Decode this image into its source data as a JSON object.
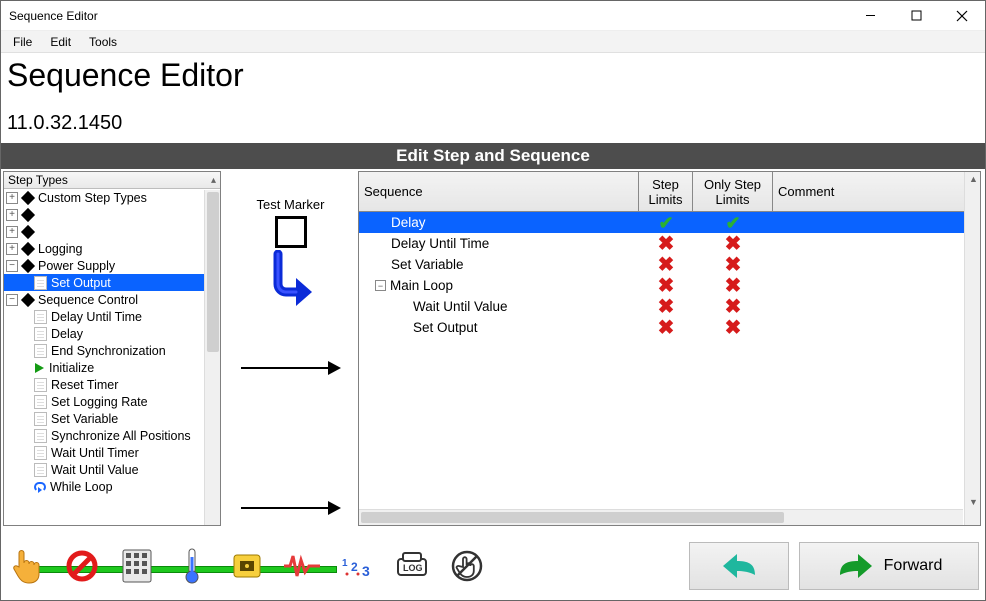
{
  "window": {
    "title": "Sequence Editor"
  },
  "menu": {
    "file": "File",
    "edit": "Edit",
    "tools": "Tools"
  },
  "header": {
    "title": "Sequence Editor",
    "version": "11.0.32.1450"
  },
  "band": {
    "title": "Edit Step and Sequence"
  },
  "tree": {
    "header": "Step Types",
    "roots": [
      {
        "label": "Custom Step Types",
        "expander": "plus",
        "kind": "diamond"
      },
      {
        "label": "",
        "expander": "plus",
        "kind": "diamond"
      },
      {
        "label": "",
        "expander": "plus",
        "kind": "diamond"
      },
      {
        "label": "Logging",
        "expander": "plus",
        "kind": "diamond"
      },
      {
        "label": "Power Supply",
        "expander": "minus",
        "kind": "diamond",
        "children": [
          {
            "label": "Set Output",
            "kind": "leaf",
            "selected": true
          }
        ]
      },
      {
        "label": "Sequence Control",
        "expander": "minus",
        "kind": "diamond",
        "children": [
          {
            "label": "Delay Until Time",
            "kind": "leaf"
          },
          {
            "label": "Delay",
            "kind": "leaf"
          },
          {
            "label": "End Synchronization",
            "kind": "leaf"
          },
          {
            "label": "Initialize",
            "kind": "play"
          },
          {
            "label": "Reset Timer",
            "kind": "leaf"
          },
          {
            "label": "Set Logging Rate",
            "kind": "leaf"
          },
          {
            "label": "Set Variable",
            "kind": "leaf"
          },
          {
            "label": "Synchronize All Positions",
            "kind": "leaf"
          },
          {
            "label": "Wait Until Timer",
            "kind": "leaf"
          },
          {
            "label": "Wait Until Value",
            "kind": "leaf"
          },
          {
            "label": "While Loop",
            "kind": "loop"
          }
        ]
      }
    ]
  },
  "middle": {
    "marker_label": "Test Marker"
  },
  "grid": {
    "columns": {
      "sequence": "Sequence",
      "step_limits": "Step Limits",
      "only_step_limits": "Only Step Limits",
      "comment": "Comment"
    },
    "rows": [
      {
        "label": "Delay",
        "indent": 1,
        "step": "ok",
        "only": "ok",
        "selected": true
      },
      {
        "label": "Delay Until Time",
        "indent": 1,
        "step": "no",
        "only": "no"
      },
      {
        "label": "Set Variable",
        "indent": 1,
        "step": "no",
        "only": "no"
      },
      {
        "label": "Main Loop",
        "indent": 1,
        "expander": "minus",
        "step": "no",
        "only": "no"
      },
      {
        "label": "Wait Until Value",
        "indent": 2,
        "step": "no",
        "only": "no"
      },
      {
        "label": "Set Output",
        "indent": 2,
        "step": "no",
        "only": "no"
      }
    ]
  },
  "footer": {
    "icons": [
      "hand-pointer-icon",
      "forbidden-icon",
      "keypad-icon",
      "thermometer-icon",
      "power-supply-icon",
      "waveform-icon",
      "numbers-icon",
      "log-icon",
      "no-touch-icon"
    ],
    "back_label": "",
    "forward_label": "Forward"
  },
  "colors": {
    "select_blue": "#0a63ff",
    "accent_green": "#1ec81e",
    "status_red": "#d61b1b",
    "ok_green": "#2bb033",
    "teal": "#1fb79e"
  }
}
